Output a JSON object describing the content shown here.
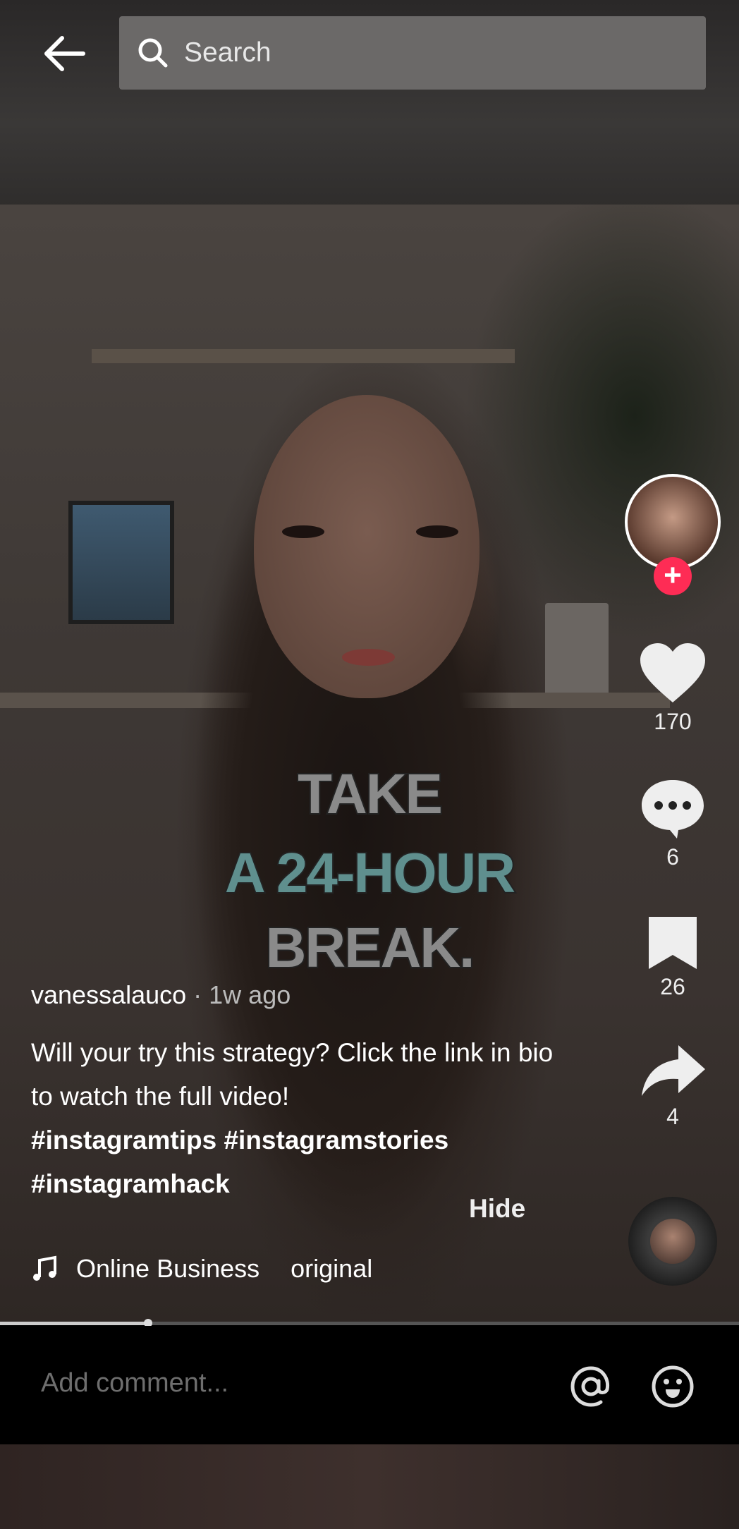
{
  "header": {
    "search_placeholder": "Search",
    "back_icon": "arrow-left-icon",
    "search_icon": "magnifier-icon"
  },
  "overlay_text": {
    "line1": "TAKE",
    "line2": "A 24-HOUR",
    "line3": "BREAK.",
    "colors": {
      "line1": "#8a8a8a",
      "line2": "#5f8f8e",
      "line3": "#8a8a8a"
    }
  },
  "actions": {
    "likes": "170",
    "comments": "6",
    "saves": "26",
    "shares": "4",
    "follow_color": "#fe2c55"
  },
  "post": {
    "username": "vanessalauco",
    "time": " · 1w ago",
    "description": "Will your try this strategy? Click the link in bio to watch the full video!",
    "tags": "#instagramtips #instagramstories #instagramhack",
    "hide_label": "Hide"
  },
  "music": {
    "title": "Online Business",
    "artist": "original"
  },
  "progress": {
    "percent": 20
  },
  "comment": {
    "placeholder": "Add comment..."
  }
}
